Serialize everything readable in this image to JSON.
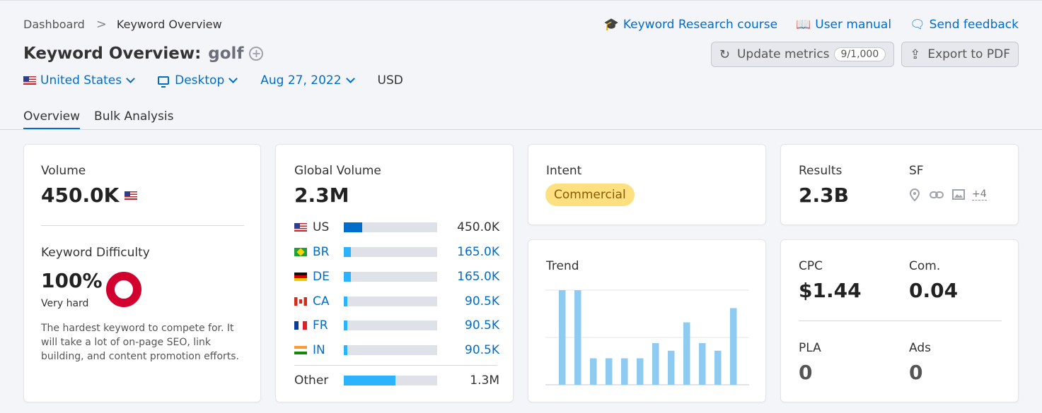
{
  "breadcrumb": {
    "home": "Dashboard",
    "separator": ">",
    "current": "Keyword Overview"
  },
  "title": {
    "prefix": "Keyword Overview:",
    "keyword": "golf",
    "add_icon": "+"
  },
  "filters": {
    "country": "United States",
    "device": "Desktop",
    "date": "Aug 27, 2022",
    "currency": "USD"
  },
  "top_links": {
    "course": "Keyword Research course",
    "manual": "User manual",
    "feedback": "Send feedback"
  },
  "icons": {
    "course": "🎓",
    "manual": "📖",
    "feedback": "🗨",
    "refresh": "↻",
    "export": "⇪"
  },
  "actions": {
    "update_label": "Update metrics",
    "update_counter": "9/1,000",
    "export_label": "Export to PDF"
  },
  "tabs": [
    {
      "label": "Overview"
    },
    {
      "label": "Bulk Analysis"
    }
  ],
  "volume": {
    "label": "Volume",
    "value": "450.0K",
    "kd_label": "Keyword Difficulty",
    "kd_value": "100%",
    "kd_level": "Very hard",
    "kd_text": "The hardest keyword to compete for. It will take a lot of on-page SEO, link building, and content promotion efforts."
  },
  "global": {
    "label": "Global Volume",
    "value": "2.3M",
    "rows": [
      {
        "code": "US",
        "value": "450.0K",
        "fraction": 0.2
      },
      {
        "code": "BR",
        "value": "165.0K",
        "fraction": 0.073
      },
      {
        "code": "DE",
        "value": "165.0K",
        "fraction": 0.073
      },
      {
        "code": "CA",
        "value": "90.5K",
        "fraction": 0.04
      },
      {
        "code": "FR",
        "value": "90.5K",
        "fraction": 0.04
      },
      {
        "code": "IN",
        "value": "90.5K",
        "fraction": 0.04
      }
    ],
    "other": {
      "label": "Other",
      "value": "1.3M",
      "fraction": 0.55
    }
  },
  "intent": {
    "label": "Intent",
    "value": "Commercial"
  },
  "results": {
    "label": "Results",
    "value": "2.3B",
    "sf_label": "SF",
    "sf_more": "+4",
    "sf_icons": [
      "location-icon",
      "link-icon",
      "image-icon"
    ]
  },
  "trend": {
    "label": "Trend",
    "values": [
      100,
      100,
      28,
      28,
      28,
      28,
      44,
      36,
      66,
      44,
      36,
      81
    ]
  },
  "cpc": {
    "cpc_label": "CPC",
    "cpc_value": "$1.44",
    "com_label": "Com.",
    "com_value": "0.04",
    "pla_label": "PLA",
    "pla_value": "0",
    "ads_label": "Ads",
    "ads_value": "0"
  },
  "colors": {
    "accent": "#006dca",
    "bar_light": "#2bb3ff",
    "trend_bar": "#8fcbf0",
    "kd_red": "#d1002f",
    "intent_bg": "#ffe081"
  }
}
